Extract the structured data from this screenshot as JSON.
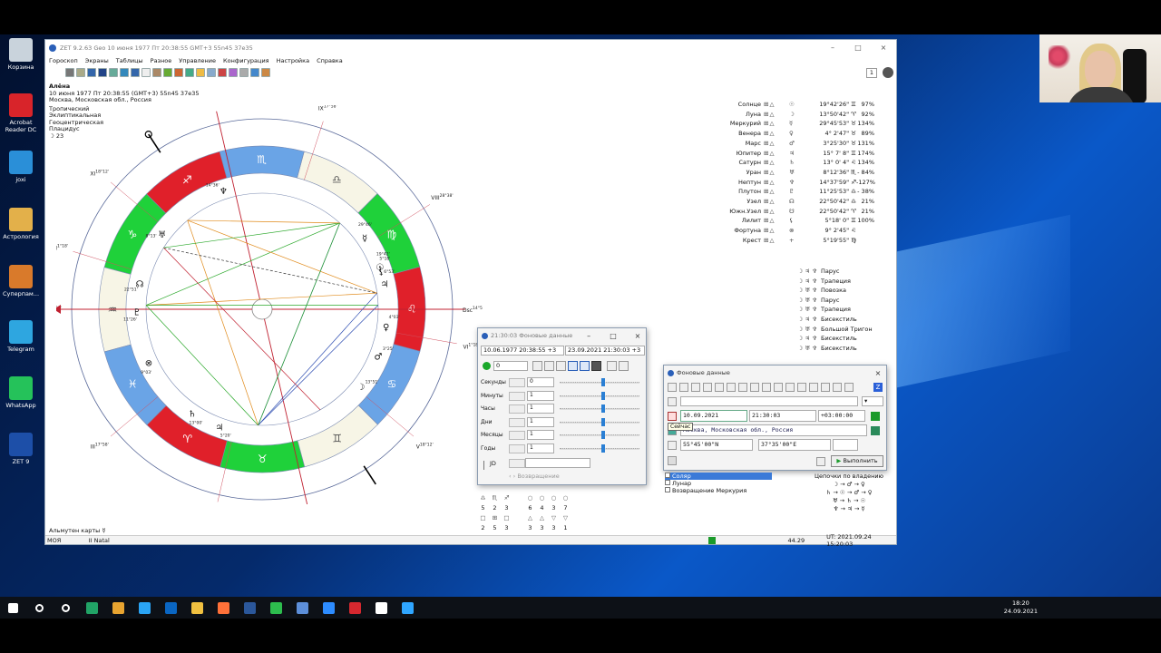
{
  "desktop": {
    "icons": [
      {
        "label": "Корзина",
        "color": "#c9d3dc"
      },
      {
        "label": "Acrobat Reader DC",
        "color": "#d8242a"
      },
      {
        "label": "joxi",
        "color": "#2a8fd8"
      },
      {
        "label": "Астрология",
        "color": "#e3b04a"
      },
      {
        "label": "Суперпам...",
        "color": "#d97a2b"
      },
      {
        "label": "Telegram",
        "color": "#2ea6e0"
      },
      {
        "label": "WhatsApp",
        "color": "#25c25a"
      },
      {
        "label": "ZET 9",
        "color": "#1d4fa8"
      }
    ]
  },
  "app": {
    "title": "ZET 9.2.63 Geo   10 июня 1977  Пт  20:38:55 GMT+3 55n45  37e35",
    "menu": [
      "Гороскоп",
      "Экраны",
      "Таблицы",
      "Разное",
      "Управление",
      "Конфигурация",
      "Настройка",
      "Справка"
    ],
    "page_number": "1",
    "person": {
      "name": "Алёна",
      "datetime": "10 июня 1977  Пт  20:38:55 (GMT+3) 55n45  37e35",
      "place": "Москва, Московская обл., Россия",
      "zodiac": "Тропический",
      "coords": "Эклиптикальная",
      "center": "Геоцентрическая",
      "houses": "Плацидус",
      "moon_day": "23"
    },
    "chart": {
      "cusps": [
        {
          "label": "Asc",
          "sup": "14°54'"
        },
        {
          "label": "Dsc",
          "sup": "14°54'"
        },
        {
          "label": "MC",
          "sup": "22°60'"
        },
        {
          "label": "IC",
          "sup": "22°60'"
        },
        {
          "label": "XI",
          "sup": "18°12'"
        },
        {
          "label": "XII",
          "sup": "1°18'"
        },
        {
          "label": "IX",
          "sup": "17°58'"
        },
        {
          "label": "VIII",
          "sup": "28°38'"
        },
        {
          "label": "VI",
          "sup": "1°18'"
        },
        {
          "label": "V",
          "sup": "18°12'"
        },
        {
          "label": "II",
          "sup": "28°38'"
        },
        {
          "label": "III",
          "sup": "17°58'"
        }
      ],
      "signs": [
        "♈",
        "♉",
        "♊",
        "♋",
        "♌",
        "♍",
        "♎",
        "♏",
        "♐",
        "♑",
        "♒",
        "♓"
      ],
      "sign_colors": {
        "fire": "#e0202a",
        "earth": "#1fd13a",
        "air": "#f7f5e6",
        "water": "#6aa4e6"
      },
      "planet_labels": [
        "5°20'",
        "13°00'",
        "9°03'",
        "11°26'",
        "22°51'",
        "8°13'",
        "14°36'",
        "19°42'",
        "29°46'",
        "13°51'",
        "4°03'",
        "3°25'",
        "6°53'",
        "5°18'"
      ]
    },
    "planets": [
      {
        "name": "Солнце",
        "sign": "☉",
        "pos": "19°42'26\" ♊",
        "pct": "97%"
      },
      {
        "name": "Луна",
        "sign": "☽",
        "pos": "13°50'42\" ♈",
        "pct": "92%"
      },
      {
        "name": "Меркурий",
        "sign": "☿",
        "pos": "29°45'53\" ♉",
        "pct": "134%"
      },
      {
        "name": "Венера",
        "sign": "♀",
        "pos": "4° 2'47\" ♉",
        "pct": "89%"
      },
      {
        "name": "Марс",
        "sign": "♂",
        "pos": "3°25'30\" ♉",
        "pct": "131%"
      },
      {
        "name": "Юпитер",
        "sign": "♃",
        "pos": "15° 7' 8\" ♊",
        "pct": "174%"
      },
      {
        "name": "Сатурн",
        "sign": "♄",
        "pos": "13° 0' 4\" ♌",
        "pct": "134%"
      },
      {
        "name": "Уран",
        "sign": "♅",
        "pos": "8°12'36\" ♏",
        "pct": "- 84%"
      },
      {
        "name": "Нептун",
        "sign": "♆",
        "pos": "14°37'59\" ♐",
        "pct": "-127%"
      },
      {
        "name": "Плутон",
        "sign": "♇",
        "pos": "11°25'53\" ♎",
        "pct": "- 38%"
      },
      {
        "name": "Узел",
        "sign": "☊",
        "pos": "22°50'42\" ♎",
        "pct": "21%"
      },
      {
        "name": "Южн.Узел",
        "sign": "☋",
        "pos": "22°50'42\" ♈",
        "pct": "21%"
      },
      {
        "name": "Лилит",
        "sign": "⚸",
        "pos": "5°18' 0\" ♊",
        "pct": "100%"
      },
      {
        "name": "Фортуна",
        "sign": "⊗",
        "pos": "9° 2'45\" ♌",
        "pct": ""
      },
      {
        "name": "Крест",
        "sign": "+",
        "pos": "5°19'55\" ♍",
        "pct": ""
      }
    ],
    "aspect_figures": [
      {
        "glyphs": "☽ ♃ ♆",
        "name": "Парус"
      },
      {
        "glyphs": "☽ ♃ ♆",
        "name": "Трапеция"
      },
      {
        "glyphs": "☽ ♅ ♆",
        "name": "Повозка"
      },
      {
        "glyphs": "☽ ♅ ♆",
        "name": "Парус"
      },
      {
        "glyphs": "☽ ♅ ♆",
        "name": "Трапеция"
      },
      {
        "glyphs": "☽ ♃ ♆",
        "name": "Бисекстиль"
      },
      {
        "glyphs": "☽ ♅ ♆",
        "name": "Большой Тригон"
      },
      {
        "glyphs": "☽ ♃ ♆",
        "name": "Бисекстиль"
      },
      {
        "glyphs": "☽ ♅ ♆",
        "name": "Бисекстиль"
      }
    ],
    "almuten": "Альмутен карты",
    "status": {
      "left": "МОЯ",
      "mid": "II Natal",
      "zoom": "44.29",
      "ut": "UT: 2021.09.24 15:20:03"
    }
  },
  "dialog_bg": {
    "title": "21:30:03 Фоновые данные",
    "from": "10.06.1977  20:38:55  +3",
    "to": "23.09.2021   21:30:03  +3",
    "step": "0",
    "rows": [
      {
        "label": "Секунды",
        "value": "0"
      },
      {
        "label": "Минуты",
        "value": "1"
      },
      {
        "label": "Часы",
        "value": "1"
      },
      {
        "label": "Дни",
        "value": "1"
      },
      {
        "label": "Месяцы",
        "value": "1"
      },
      {
        "label": "Годы",
        "value": "1"
      }
    ],
    "jd_label": "JD",
    "return_label": "Возвращение"
  },
  "dialog_bg2": {
    "title": "Фоновые данные",
    "date": "10.09.2021",
    "time": "21:30:03",
    "tz": "+03:00:00",
    "place": "Москва, Московская обл., Россия",
    "lat": "55°45'00\"N",
    "lon": "37°35'00\"E",
    "execute": "Выполнить",
    "tooltip": "Сейчас"
  },
  "list": [
    "Соляр",
    "Лунар",
    "Возвращение Меркурия"
  ],
  "chains": {
    "title": "Цепочки по владению",
    "lines": [
      "☽ → ♂ → ♀",
      "♄ → ☉ → ♂ → ♀",
      "♅ → ♄ → ☉",
      "♆ → ♃ → ☿"
    ]
  },
  "counts": {
    "row1": [
      "5",
      "2",
      "3",
      "",
      "6",
      "4",
      "3",
      "7"
    ],
    "row2": [
      "2",
      "5",
      "3",
      "",
      "3",
      "3",
      "3",
      "1"
    ]
  },
  "clock": {
    "time": "18:20",
    "date": "24.09.2021"
  },
  "taskbar": {
    "colors": [
      "#ffffff",
      "#ffffff",
      "#ffffff",
      "#e34c26",
      "#21a366",
      "#e8a430",
      "#2aa4f4",
      "#0a66c2",
      "#f0c040",
      "#ff7139",
      "#2b579a",
      "#2dbd4e",
      "#5d8fd9",
      "#2d8cff",
      "#d6282f",
      "#ffffff",
      "#2fa6ff"
    ]
  }
}
